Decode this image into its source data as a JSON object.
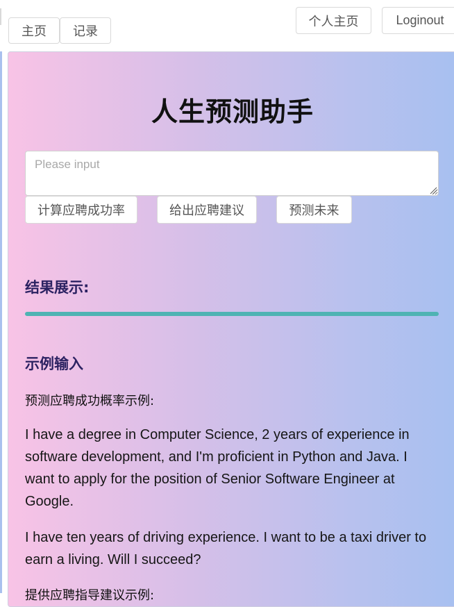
{
  "nav": {
    "home_label": "主页",
    "record_label": "记录",
    "profile_label": "个人主页",
    "logout_label": "Loginout"
  },
  "main": {
    "title": "人生预测助手",
    "input": {
      "placeholder": "Please input",
      "value": ""
    },
    "buttons": {
      "calc_label": "计算应聘成功率",
      "advice_label": "给出应聘建议",
      "predict_label": "预测未来"
    },
    "result_heading": "结果展示:",
    "example_heading": "示例输入",
    "examples": [
      {
        "label": "预测应聘成功概率示例:",
        "text": "I have a degree in Computer Science, 2 years of experience in software development, and I'm proficient in Python and Java. I want to apply for the position of Senior Software Engineer at Google."
      },
      {
        "text": "I have ten years of driving experience. I want to be a taxi driver to earn a living. Will I succeed?"
      },
      {
        "label": "提供应聘指导建议示例:"
      }
    ]
  },
  "colors": {
    "gradient_left": "#f8c3e6",
    "gradient_right": "#a6c0f0",
    "divider": "#4fb3b3",
    "heading": "#2c2262"
  }
}
